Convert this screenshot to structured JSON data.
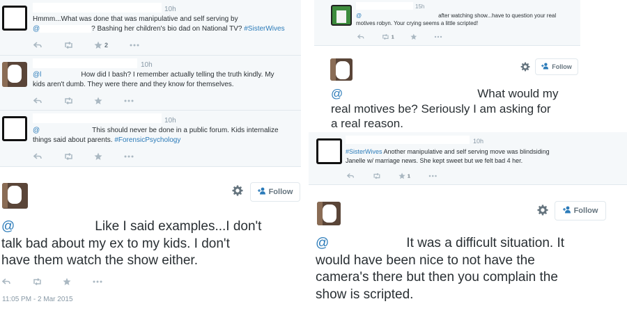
{
  "left_panel": {
    "replies": [
      {
        "time": "10h",
        "line1": "Hmmm...What was done that was manipulative and self serving by",
        "line2_at": "@",
        "line2_text": "?  Bashing her children's bio dad on National TV?",
        "hashtag": "#SisterWives",
        "fav_count": "2"
      },
      {
        "time": "10h",
        "line1_at": "@l",
        "line1_text": "How did I bash? I remember actually telling the truth kindly.  My",
        "line2": "kids aren't dumb. They were there and they know for themselves."
      },
      {
        "time": "10h",
        "line1_at": "@",
        "line1_text": "This should never be done in a public forum.  Kids internalize",
        "line2": "things said about parents.",
        "hashtag": "#ForensicPsychology"
      }
    ],
    "main": {
      "follow_label": "Follow",
      "at": "@",
      "line1": "Like I said examples...I don't",
      "line2": "talk bad about my ex to my kids.  I don't",
      "line3": "have them watch the show either.",
      "timestamp": "11:05 PM - 2 Mar 2015"
    }
  },
  "right_top": {
    "time": "15h",
    "line1_at": "@",
    "line1_text": "after watching show...have to question your real",
    "line2": "motives robyn.  Your crying seems a little scripted!",
    "rt_count": "1",
    "follow_label": "Follow",
    "big_at": "@",
    "big_line1": "What would my",
    "big_line2": "real motives be?  Seriously I am asking for",
    "big_line3": "a real reason."
  },
  "right_bottom": {
    "time": "10h",
    "hashtag": "#SisterWives",
    "line1_text": "Another manipulative and self serving move was blindsiding",
    "line2": "Janelle w/ marriage news. She kept sweet but we felt bad 4 her.",
    "fav_count": "1",
    "follow_label": "Follow",
    "big_at": "@",
    "big_line1": "It was a difficult situation.  It",
    "big_line2": "would have been nice to not have the",
    "big_line3": "camera's there but then you complain the",
    "big_line4": "show is scripted."
  },
  "icons": {
    "reply": "reply-icon",
    "retweet": "retweet-icon",
    "favorite": "star-icon",
    "more": "more-icon",
    "gear": "gear-icon",
    "follow": "add-user-icon"
  },
  "colors": {
    "link": "#2b7bb9",
    "reply_background": "#f5f8fa",
    "divider": "#e1e8ed",
    "muted": "#8899a6"
  }
}
